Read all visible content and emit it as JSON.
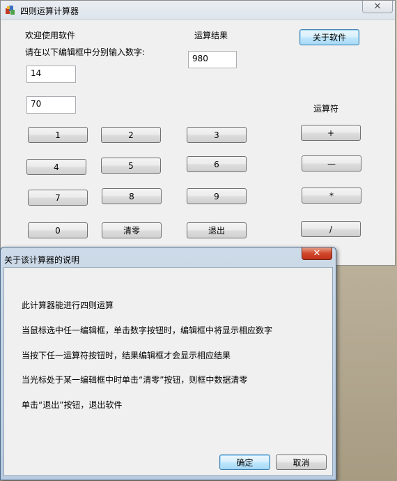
{
  "main_window": {
    "title": "四则运算计算器",
    "close_glyph": "✕",
    "welcome": "欢迎使用软件",
    "instruction": "请在以下编辑框中分别输入数字:",
    "input1": "14",
    "input2": "70",
    "result_label": "运算结果",
    "result_value": "980",
    "about_button": "关于软件",
    "operator_label": "运算符",
    "digits": [
      "1",
      "2",
      "3",
      "4",
      "5",
      "6",
      "7",
      "8",
      "9",
      "0"
    ],
    "clear_button": "清零",
    "exit_button": "退出",
    "operators": [
      "+",
      "—",
      "*",
      "/"
    ]
  },
  "dialog": {
    "title": "关于该计算器的说明",
    "close_glyph": "✕",
    "lines": [
      "此计算器能进行四则运算",
      "当鼠标选中任一编辑框，单击数字按钮时，编辑框中将显示相应数字",
      "当按下任一运算符按钮时，结果编辑框才会显示相应结果",
      "当光标处于某一编辑框中时单击“清零”按钮，则框中数据清零",
      "单击“退出”按钮，退出软件"
    ],
    "ok_button": "确定",
    "cancel_button": "取消"
  },
  "colors": {
    "window_bg": "#f0f0f0",
    "close_active": "#c0321a",
    "default_button_border": "#3c7fb1"
  },
  "icons": {
    "app": "calculator-app-icon",
    "close": "close-icon"
  }
}
